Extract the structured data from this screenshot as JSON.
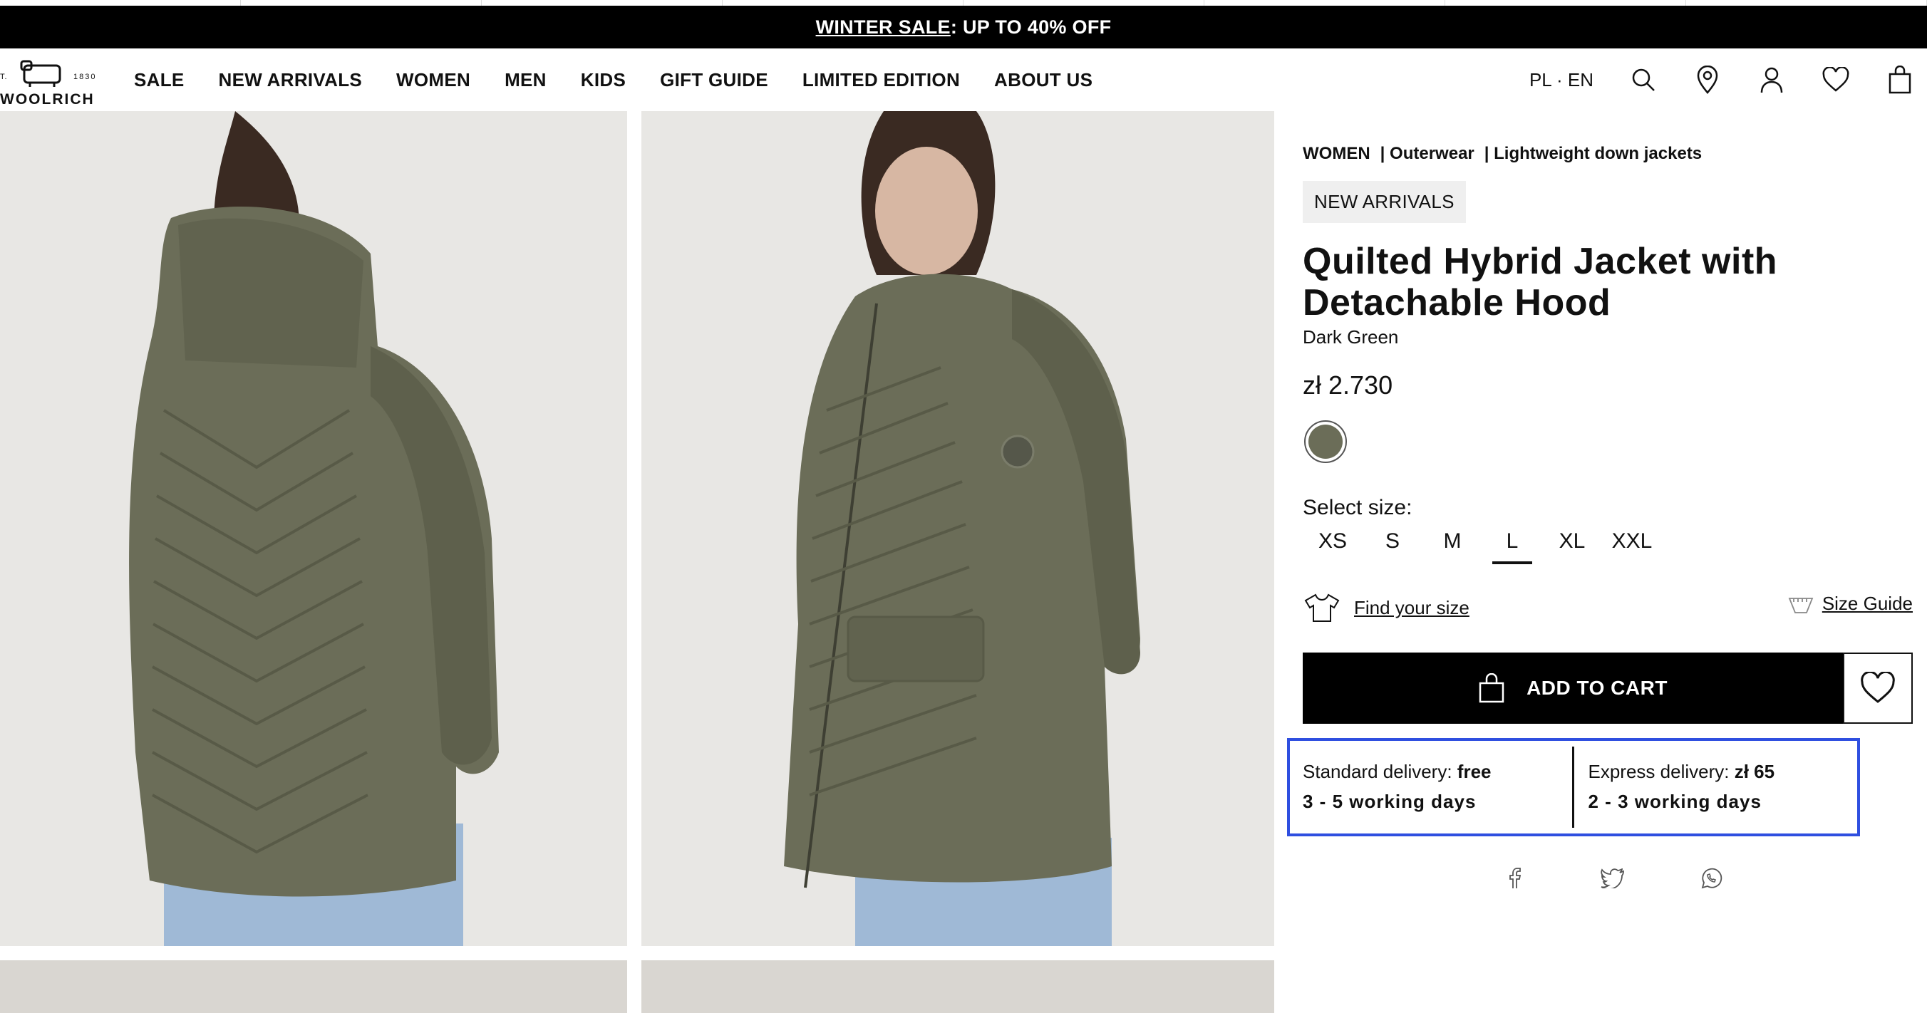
{
  "promo": {
    "link": "WINTER SALE",
    "rest": ": UP TO 40% OFF"
  },
  "logo": {
    "est": "T.",
    "year": "1830",
    "name": "WOOLRICH"
  },
  "nav": [
    "SALE",
    "NEW ARRIVALS",
    "WOMEN",
    "MEN",
    "KIDS",
    "GIFT GUIDE",
    "LIMITED EDITION",
    "ABOUT US"
  ],
  "header_tools": {
    "language": "PL · EN",
    "icons": [
      "search-icon",
      "store-locator-icon",
      "account-icon",
      "wishlist-icon",
      "bag-icon"
    ]
  },
  "breadcrumb": [
    "WOMEN",
    "| Outerwear",
    "| Lightweight down jackets"
  ],
  "product": {
    "badge": "NEW ARRIVALS",
    "title": "Quilted Hybrid Jacket with Detachable Hood",
    "color": "Dark Green",
    "price": "zł 2.730",
    "swatch_color": "#6b6d58"
  },
  "sizes": {
    "label": "Select size:",
    "options": [
      "XS",
      "S",
      "M",
      "L",
      "XL",
      "XXL"
    ],
    "selected": "L"
  },
  "fit": {
    "find_your_size": "Find your size",
    "size_guide": "Size Guide"
  },
  "cart": {
    "add_to_cart": "ADD TO CART"
  },
  "delivery": {
    "standard_label": "Standard delivery: ",
    "standard_price": "free",
    "standard_days": "3 - 5 working days",
    "express_label": "Express delivery: ",
    "express_price": "zł 65",
    "express_days": "2 - 3 working days"
  },
  "share_icons": [
    "facebook-icon",
    "twitter-icon",
    "whatsapp-icon"
  ],
  "colors": {
    "promo_bg": "#000000",
    "highlight_border": "#2f4fe0",
    "jacket": "#6b6d58"
  }
}
